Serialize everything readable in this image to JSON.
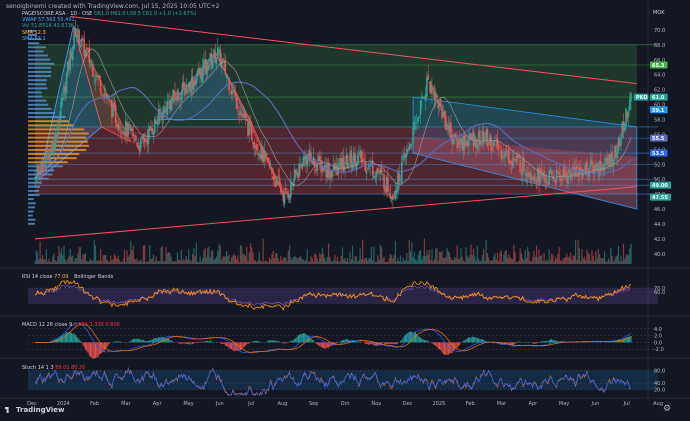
{
  "attribution": "senoigbinemi created with TradingView.com, Jul 15, 2025 10:05 UTC+2",
  "currency": "MOK",
  "brand": "TradingView",
  "legend": {
    "symbol": "PAGEISCORE ASA · 1D · OSE",
    "ohlc": "O61.0 H61.0 L58.5 C61.0 +1.0 (+1.67%)",
    "vwap": "VWAP 57.563 55.491",
    "vol": "Vol 51.851K 43.673K",
    "sma1": "SMA 52.3",
    "sma2": "SMA 53.1"
  },
  "indicators": {
    "rsi": {
      "label": "RSI 14 close",
      "value": "77.09",
      "sub": "Bollinger Bands"
    },
    "macd": {
      "label": "MACD 12 26 close 9",
      "values": "0.526 1.335 0.808"
    },
    "stoch": {
      "label": "Stoch 14 1 3",
      "values": "88.01 80.20"
    }
  },
  "colors": {
    "background": "#131722",
    "up": "#26a69a",
    "down": "#ef5350",
    "trendline": "#f7525f",
    "upper_box": "#4caf50",
    "channel": "#2196f3",
    "vp_high": "#ffa726",
    "vp_low": "#5e9ce6",
    "ma": "#3949ab"
  },
  "chart_data": [
    {
      "type": "candlestick",
      "title": "",
      "x": [
        "Dec",
        "2024",
        "Feb",
        "Mar",
        "Apr",
        "May",
        "Jun",
        "Jul",
        "Aug",
        "Sep",
        "Oct",
        "Nov",
        "Dec",
        "2025",
        "Feb",
        "Mar",
        "Apr",
        "May",
        "Jun",
        "Jul",
        "Aug"
      ],
      "y_ticks": [
        40.0,
        42.0,
        44.0,
        46.0,
        48.0,
        50.0,
        52.0,
        54.0,
        56.0,
        58.0,
        60.0,
        62.0,
        64.0,
        66.0,
        68.0,
        70.0
      ],
      "ylim": [
        38.5,
        72
      ],
      "price_waypoints": [
        {
          "date": "2023-12-01",
          "close": 50.0
        },
        {
          "date": "2023-12-20",
          "close": 55.0
        },
        {
          "date": "2024-01-10",
          "close": 70.0
        },
        {
          "date": "2024-02-20",
          "close": 58.0
        },
        {
          "date": "2024-03-15",
          "close": 54.5
        },
        {
          "date": "2024-04-10",
          "close": 60.0
        },
        {
          "date": "2024-05-05",
          "close": 63.0
        },
        {
          "date": "2024-05-30",
          "close": 67.0
        },
        {
          "date": "2024-06-25",
          "close": 58.0
        },
        {
          "date": "2024-08-05",
          "close": 47.5
        },
        {
          "date": "2024-08-25",
          "close": 53.0
        },
        {
          "date": "2024-09-20",
          "close": 51.0
        },
        {
          "date": "2024-10-15",
          "close": 53.0
        },
        {
          "date": "2024-11-05",
          "close": 51.0
        },
        {
          "date": "2024-11-20",
          "close": 48.0
        },
        {
          "date": "2024-12-10",
          "close": 56.0
        },
        {
          "date": "2024-12-25",
          "close": 63.5
        },
        {
          "date": "2025-01-20",
          "close": 55.0
        },
        {
          "date": "2025-02-20",
          "close": 55.5
        },
        {
          "date": "2025-03-20",
          "close": 52.5
        },
        {
          "date": "2025-04-20",
          "close": 50.0
        },
        {
          "date": "2025-05-20",
          "close": 51.0
        },
        {
          "date": "2025-06-20",
          "close": 52.0
        },
        {
          "date": "2025-07-01",
          "close": 54.0
        },
        {
          "date": "2025-07-10",
          "close": 59.0
        },
        {
          "date": "2025-07-15",
          "close": 61.0
        }
      ],
      "price_labels": [
        {
          "text": "65.3",
          "price": 65.3,
          "color": "#4caf50"
        },
        {
          "text": "PKO",
          "price": 61.0,
          "color": "#26a69a"
        },
        {
          "text": "61.0",
          "price": 61.0,
          "color": "#26a69a"
        },
        {
          "text": "59.1",
          "price": 59.3,
          "color": "#2196f3"
        },
        {
          "text": "55.5",
          "price": 55.5,
          "color": "#5c6bc0"
        },
        {
          "text": "53.5",
          "price": 53.5,
          "color": "#2962ff"
        },
        {
          "text": "49.00",
          "price": 49.2,
          "color": "#26a69a"
        },
        {
          "text": "47.55",
          "price": 47.6,
          "color": "#26a69a"
        }
      ],
      "trendlines": [
        {
          "from": {
            "date": "2024-01-05",
            "price": 71.8
          },
          "to": {
            "date": "2025-07-20",
            "price": 62.8
          }
        },
        {
          "from": {
            "date": "2023-12-01",
            "price": 42.0
          },
          "to": {
            "date": "2025-07-20",
            "price": 49.0
          }
        }
      ],
      "zones": [
        {
          "kind": "green",
          "from": "2023-12-01",
          "to": "2025-07-20",
          "top": 68.0,
          "bottom": 57.0
        },
        {
          "kind": "red",
          "from": "2023-12-01",
          "to": "2025-07-20",
          "top": 57.0,
          "bottom": 48.0
        },
        {
          "kind": "channel",
          "from": "2024-12-10",
          "to": "2025-07-20",
          "top_start": 61.0,
          "top_end": 57.0,
          "bottom_start": 53.5,
          "bottom_end": 46.0
        }
      ]
    },
    {
      "type": "line",
      "name": "RSI",
      "ylim": [
        0,
        100
      ],
      "y_ticks": [
        70.0,
        60.0
      ],
      "last": 77.09
    },
    {
      "type": "histogram",
      "name": "MACD",
      "ylim": [
        -4,
        6
      ],
      "y_ticks": [
        4.0,
        2.0,
        0.0,
        -2.0
      ],
      "last": 0.526
    },
    {
      "type": "line",
      "name": "Stoch",
      "ylim": [
        0,
        100
      ],
      "y_ticks": [
        80.0,
        40.0,
        20.0
      ],
      "last": 88.01
    }
  ]
}
